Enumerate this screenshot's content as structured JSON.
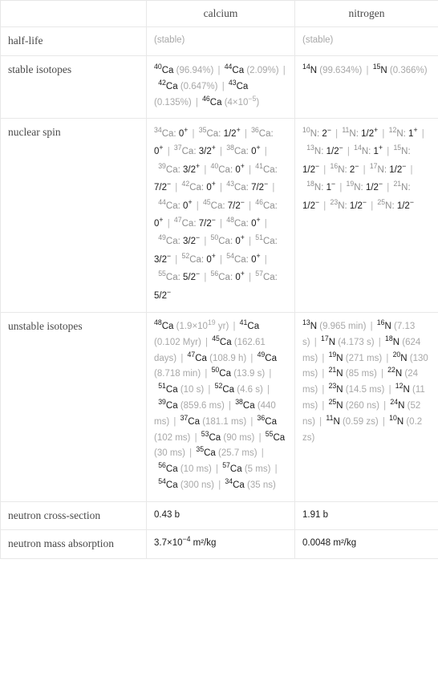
{
  "table": {
    "columns": [
      "",
      "calcium",
      "nitrogen"
    ],
    "rows": [
      {
        "label": "half-life",
        "calcium": "(stable)",
        "nitrogen": "(stable)"
      },
      {
        "label": "stable isotopes",
        "calcium": "⁴⁰Ca (96.94%) | ⁴⁴Ca (2.09%) | ⁴²Ca (0.647%) | ⁴³Ca (0.135%) | ⁴⁶Ca (4×10⁻⁵)",
        "nitrogen": "¹⁴N (99.634%) | ¹⁵N (0.366%)"
      },
      {
        "label": "nuclear spin",
        "calcium": "³⁴Ca: 0⁺ | ³⁵Ca: 1/2⁺ | ³⁶Ca: 0⁺ | ³⁷Ca: 3/2⁺ | ³⁸Ca: 0⁺ | ³⁹Ca: 3/2⁺ | ⁴⁰Ca: 0⁺ | ⁴¹Ca: 7/2⁻ | ⁴²Ca: 0⁺ | ⁴³Ca: 7/2⁻ | ⁴⁴Ca: 0⁺ | ⁴⁵Ca: 7/2⁻ | ⁴⁶Ca: 0⁺ | ⁴⁷Ca: 7/2⁻ | ⁴⁸Ca: 0⁺ | ⁴⁹Ca: 3/2⁻ | ⁵⁰Ca: 0⁺ | ⁵¹Ca: 3/2⁻ | ⁵²Ca: 0⁺ | ⁵⁴Ca: 0⁺ | ⁵⁵Ca: 5/2⁻ | ⁵⁶Ca: 0⁺ | ⁵⁷Ca: 5/2⁻",
        "nitrogen": "¹⁰N: 2⁻ | ¹¹N: 1/2⁺ | ¹²N: 1⁺ | ¹³N: 1/2⁻ | ¹⁴N: 1⁺ | ¹⁵N: 1/2⁻ | ¹⁶N: 2⁻ | ¹⁷N: 1/2⁻ | ¹⁸N: 1⁻ | ¹⁹N: 1/2⁻ | ²¹N: 1/2⁻ | ²³N: 1/2⁻ | ²⁵N: 1/2⁻"
      },
      {
        "label": "unstable isotopes",
        "calcium": "⁴⁸Ca (1.9×10¹⁹ yr) | ⁴¹Ca (0.102 Myr) | ⁴⁵Ca (162.61 days) | ⁴⁷Ca (108.9 h) | ⁴⁹Ca (8.718 min) | ⁵⁰Ca (13.9 s) | ⁵¹Ca (10 s) | ⁵²Ca (4.6 s) | ³⁹Ca (859.6 ms) | ³⁸Ca (440 ms) | ³⁷Ca (181.1 ms) | ³⁶Ca (102 ms) | ⁵³Ca (90 ms) | ⁵⁵Ca (30 ms) | ³⁵Ca (25.7 ms) | ⁵⁶Ca (10 ms) | ⁵⁷Ca (5 ms) | ⁵⁴Ca (300 ns) | ³⁴Ca (35 ns)",
        "nitrogen": "¹³N (9.965 min) | ¹⁶N (7.13 s) | ¹⁷N (4.173 s) | ¹⁸N (624 ms) | ¹⁹N (271 ms) | ²⁰N (130 ms) | ²¹N (85 ms) | ²²N (24 ms) | ²³N (14.5 ms) | ¹²N (11 ms) | ²⁵N (260 ns) | ²⁴N (52 ns) | ¹¹N (0.59 zs) | ¹⁰N (0.2 zs)"
      },
      {
        "label": "neutron cross-section",
        "calcium": "0.43 b",
        "nitrogen": "1.91 b"
      },
      {
        "label": "neutron mass absorption",
        "calcium": "3.7×10⁻⁴ m²/kg",
        "nitrogen": "0.0048 m²/kg"
      }
    ]
  },
  "isotope_data": {
    "calcium": {
      "half_life": "(stable)",
      "neutron_cross_section": "0.43 b",
      "neutron_mass_absorption": "3.7×10⁻⁴ m²/kg",
      "stable_isotopes": [
        {
          "mass": 40,
          "symbol": "Ca",
          "abundance": "96.94%"
        },
        {
          "mass": 44,
          "symbol": "Ca",
          "abundance": "2.09%"
        },
        {
          "mass": 42,
          "symbol": "Ca",
          "abundance": "0.647%"
        },
        {
          "mass": 43,
          "symbol": "Ca",
          "abundance": "0.135%"
        },
        {
          "mass": 46,
          "symbol": "Ca",
          "abundance": "4×10^-5"
        }
      ],
      "nuclear_spin": [
        {
          "mass": 34,
          "spin": "0+"
        },
        {
          "mass": 35,
          "spin": "1/2+"
        },
        {
          "mass": 36,
          "spin": "0+"
        },
        {
          "mass": 37,
          "spin": "3/2+"
        },
        {
          "mass": 38,
          "spin": "0+"
        },
        {
          "mass": 39,
          "spin": "3/2+"
        },
        {
          "mass": 40,
          "spin": "0+"
        },
        {
          "mass": 41,
          "spin": "7/2-"
        },
        {
          "mass": 42,
          "spin": "0+"
        },
        {
          "mass": 43,
          "spin": "7/2-"
        },
        {
          "mass": 44,
          "spin": "0+"
        },
        {
          "mass": 45,
          "spin": "7/2-"
        },
        {
          "mass": 46,
          "spin": "0+"
        },
        {
          "mass": 47,
          "spin": "7/2-"
        },
        {
          "mass": 48,
          "spin": "0+"
        },
        {
          "mass": 49,
          "spin": "3/2-"
        },
        {
          "mass": 50,
          "spin": "0+"
        },
        {
          "mass": 51,
          "spin": "3/2-"
        },
        {
          "mass": 52,
          "spin": "0+"
        },
        {
          "mass": 54,
          "spin": "0+"
        },
        {
          "mass": 55,
          "spin": "5/2-"
        },
        {
          "mass": 56,
          "spin": "0+"
        },
        {
          "mass": 57,
          "spin": "5/2-"
        }
      ],
      "unstable_isotopes": [
        {
          "mass": 48,
          "half_life": "1.9×10^19 yr"
        },
        {
          "mass": 41,
          "half_life": "0.102 Myr"
        },
        {
          "mass": 45,
          "half_life": "162.61 days"
        },
        {
          "mass": 47,
          "half_life": "108.9 h"
        },
        {
          "mass": 49,
          "half_life": "8.718 min"
        },
        {
          "mass": 50,
          "half_life": "13.9 s"
        },
        {
          "mass": 51,
          "half_life": "10 s"
        },
        {
          "mass": 52,
          "half_life": "4.6 s"
        },
        {
          "mass": 39,
          "half_life": "859.6 ms"
        },
        {
          "mass": 38,
          "half_life": "440 ms"
        },
        {
          "mass": 37,
          "half_life": "181.1 ms"
        },
        {
          "mass": 36,
          "half_life": "102 ms"
        },
        {
          "mass": 53,
          "half_life": "90 ms"
        },
        {
          "mass": 55,
          "half_life": "30 ms"
        },
        {
          "mass": 35,
          "half_life": "25.7 ms"
        },
        {
          "mass": 56,
          "half_life": "10 ms"
        },
        {
          "mass": 57,
          "half_life": "5 ms"
        },
        {
          "mass": 54,
          "half_life": "300 ns"
        },
        {
          "mass": 34,
          "half_life": "35 ns"
        }
      ]
    },
    "nitrogen": {
      "half_life": "(stable)",
      "neutron_cross_section": "1.91 b",
      "neutron_mass_absorption": "0.0048 m²/kg",
      "stable_isotopes": [
        {
          "mass": 14,
          "symbol": "N",
          "abundance": "99.634%"
        },
        {
          "mass": 15,
          "symbol": "N",
          "abundance": "0.366%"
        }
      ],
      "nuclear_spin": [
        {
          "mass": 10,
          "spin": "2-"
        },
        {
          "mass": 11,
          "spin": "1/2+"
        },
        {
          "mass": 12,
          "spin": "1+"
        },
        {
          "mass": 13,
          "spin": "1/2-"
        },
        {
          "mass": 14,
          "spin": "1+"
        },
        {
          "mass": 15,
          "spin": "1/2-"
        },
        {
          "mass": 16,
          "spin": "2-"
        },
        {
          "mass": 17,
          "spin": "1/2-"
        },
        {
          "mass": 18,
          "spin": "1-"
        },
        {
          "mass": 19,
          "spin": "1/2-"
        },
        {
          "mass": 21,
          "spin": "1/2-"
        },
        {
          "mass": 23,
          "spin": "1/2-"
        },
        {
          "mass": 25,
          "spin": "1/2-"
        }
      ],
      "unstable_isotopes": [
        {
          "mass": 13,
          "half_life": "9.965 min"
        },
        {
          "mass": 16,
          "half_life": "7.13 s"
        },
        {
          "mass": 17,
          "half_life": "4.173 s"
        },
        {
          "mass": 18,
          "half_life": "624 ms"
        },
        {
          "mass": 19,
          "half_life": "271 ms"
        },
        {
          "mass": 20,
          "half_life": "130 ms"
        },
        {
          "mass": 21,
          "half_life": "85 ms"
        },
        {
          "mass": 22,
          "half_life": "24 ms"
        },
        {
          "mass": 23,
          "half_life": "14.5 ms"
        },
        {
          "mass": 12,
          "half_life": "11 ms"
        },
        {
          "mass": 25,
          "half_life": "260 ns"
        },
        {
          "mass": 24,
          "half_life": "52 ns"
        },
        {
          "mass": 11,
          "half_life": "0.59 zs"
        },
        {
          "mass": 10,
          "half_life": "0.2 zs"
        }
      ]
    }
  }
}
